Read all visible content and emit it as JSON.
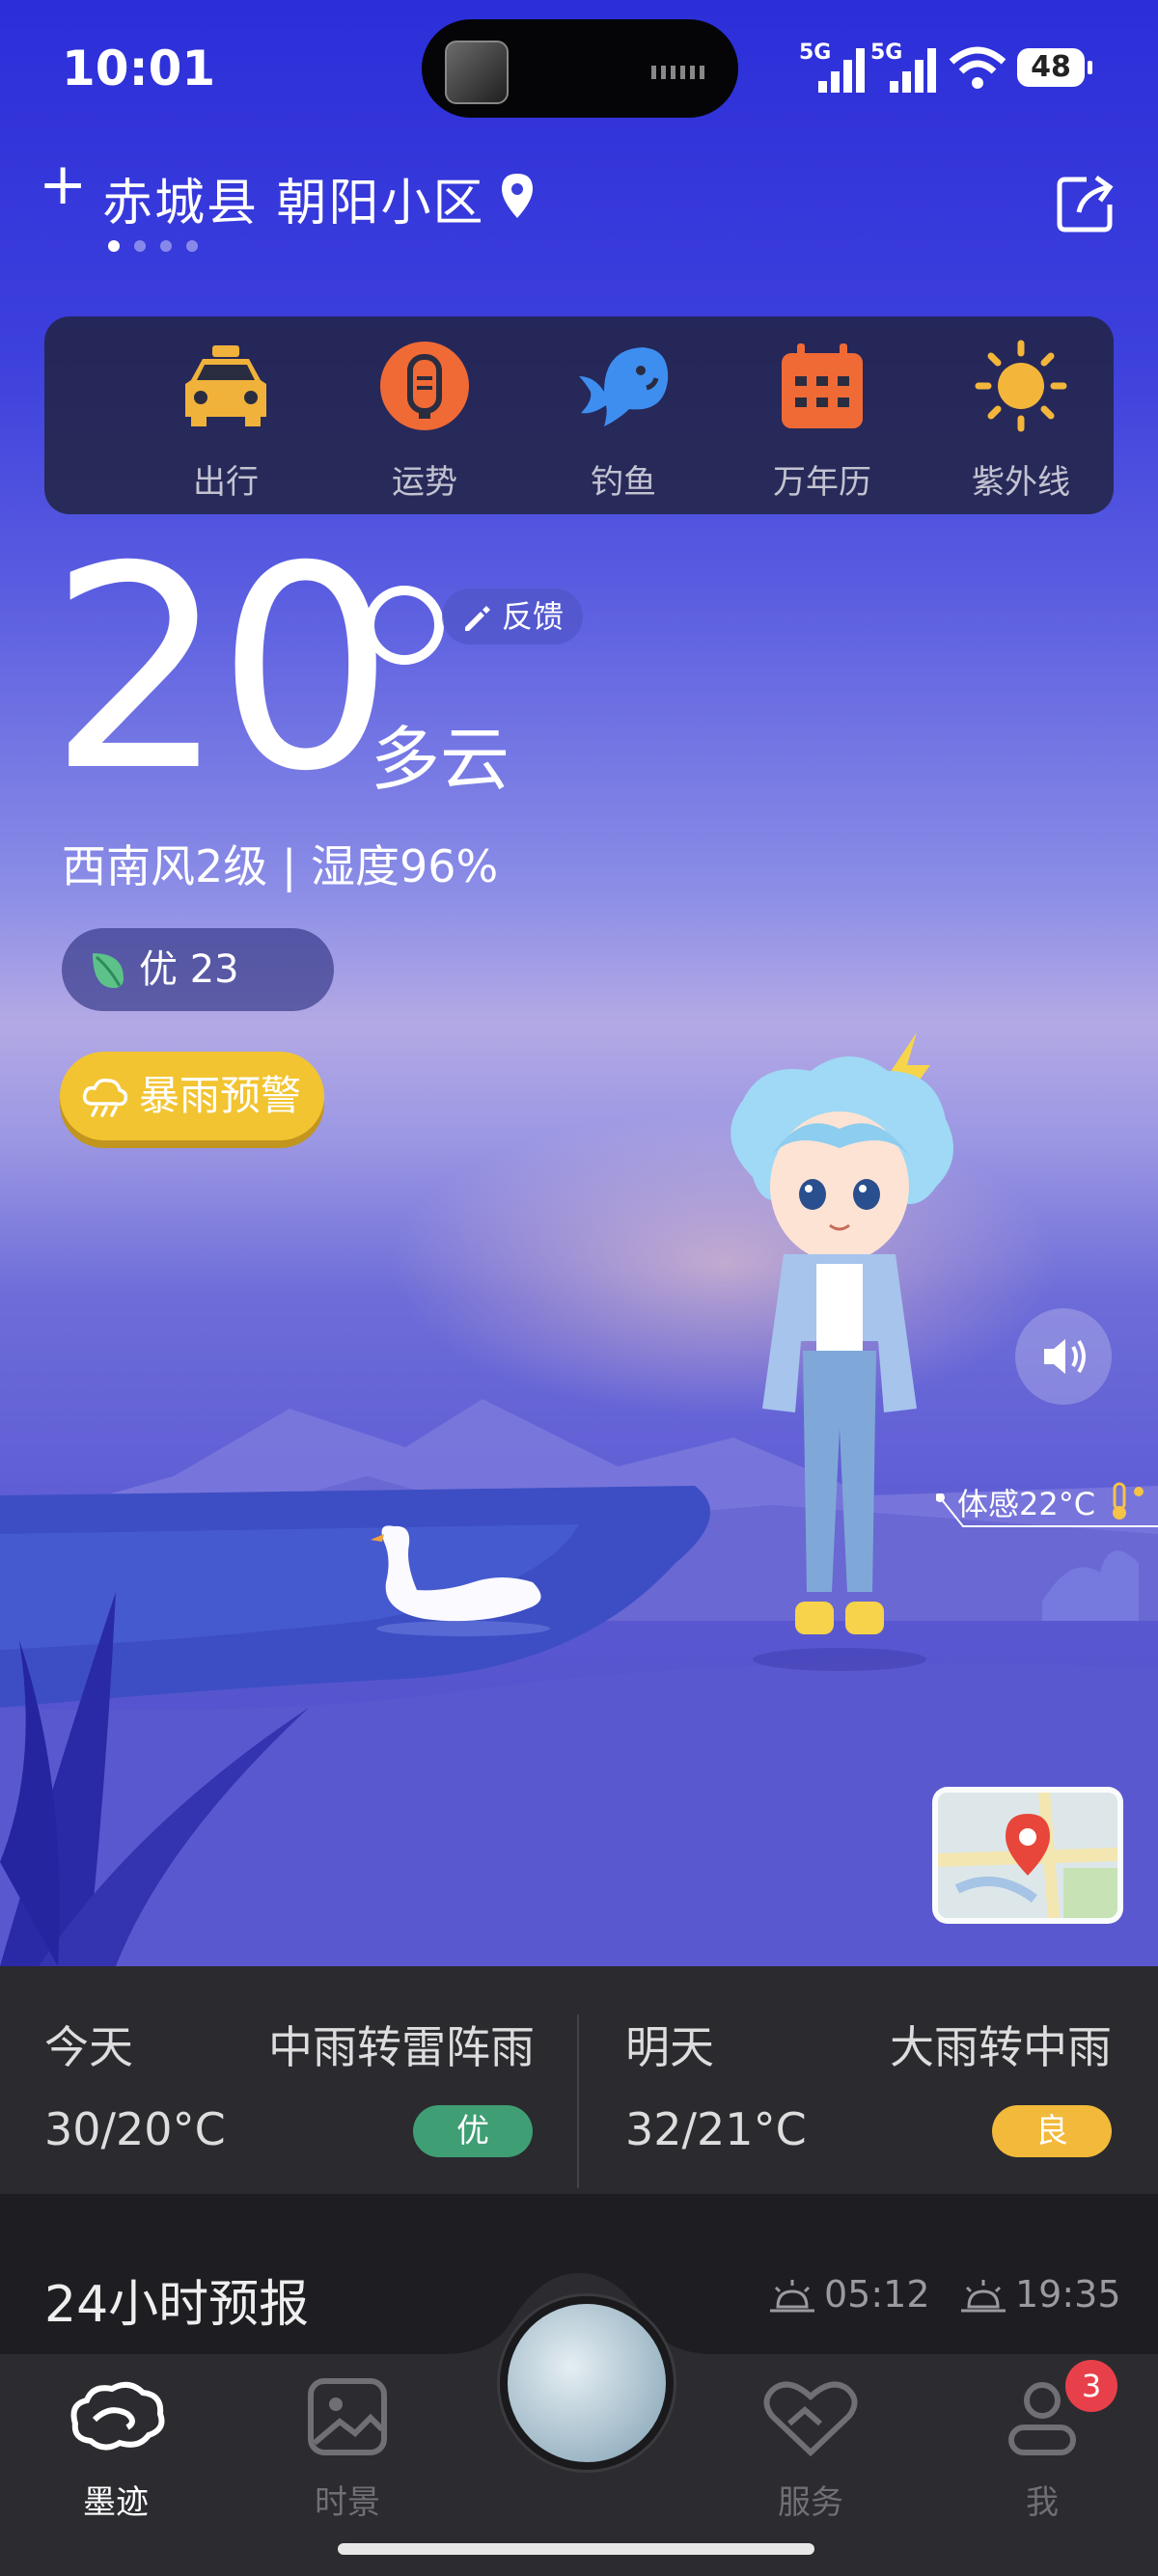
{
  "status_bar": {
    "time": "10:01",
    "network1": "5G",
    "network2": "5G",
    "battery": "48"
  },
  "location": {
    "name": "赤城县 朝阳小区",
    "page_count": 4,
    "active_page": 1
  },
  "tools": [
    {
      "label": "出行",
      "icon": "taxi-icon",
      "color": "#f0b23a"
    },
    {
      "label": "运势",
      "icon": "fortune-icon",
      "color": "#f06a36"
    },
    {
      "label": "钓鱼",
      "icon": "fish-icon",
      "color": "#3e8ef0"
    },
    {
      "label": "万年历",
      "icon": "calendar-icon",
      "color": "#f06a36"
    },
    {
      "label": "紫外线",
      "icon": "sun-icon",
      "color": "#f3b63b"
    }
  ],
  "current": {
    "temperature": "20",
    "condition": "多云",
    "feedback_label": "反馈",
    "wind_humidity": "西南风2级 | 湿度96%",
    "aqi": "优 23",
    "alert": "暴雨预警",
    "feels_like": "体感22°C"
  },
  "forecast": {
    "today": {
      "day": "今天",
      "weather": "中雨转雷阵雨",
      "range": "30/20°C",
      "aqi": "优",
      "aqi_color": "#3f9e73"
    },
    "tomorrow": {
      "day": "明天",
      "weather": "大雨转中雨",
      "range": "32/21°C",
      "aqi": "良",
      "aqi_color": "#f2b93a"
    }
  },
  "hourly": {
    "title": "24小时预报",
    "sunrise": "05:12",
    "sunset": "19:35"
  },
  "nav": {
    "items": [
      {
        "label": "墨迹",
        "active": true
      },
      {
        "label": "时景",
        "active": false
      },
      {
        "label": "服务",
        "active": false
      },
      {
        "label": "我",
        "active": false,
        "badge": "3"
      }
    ]
  }
}
